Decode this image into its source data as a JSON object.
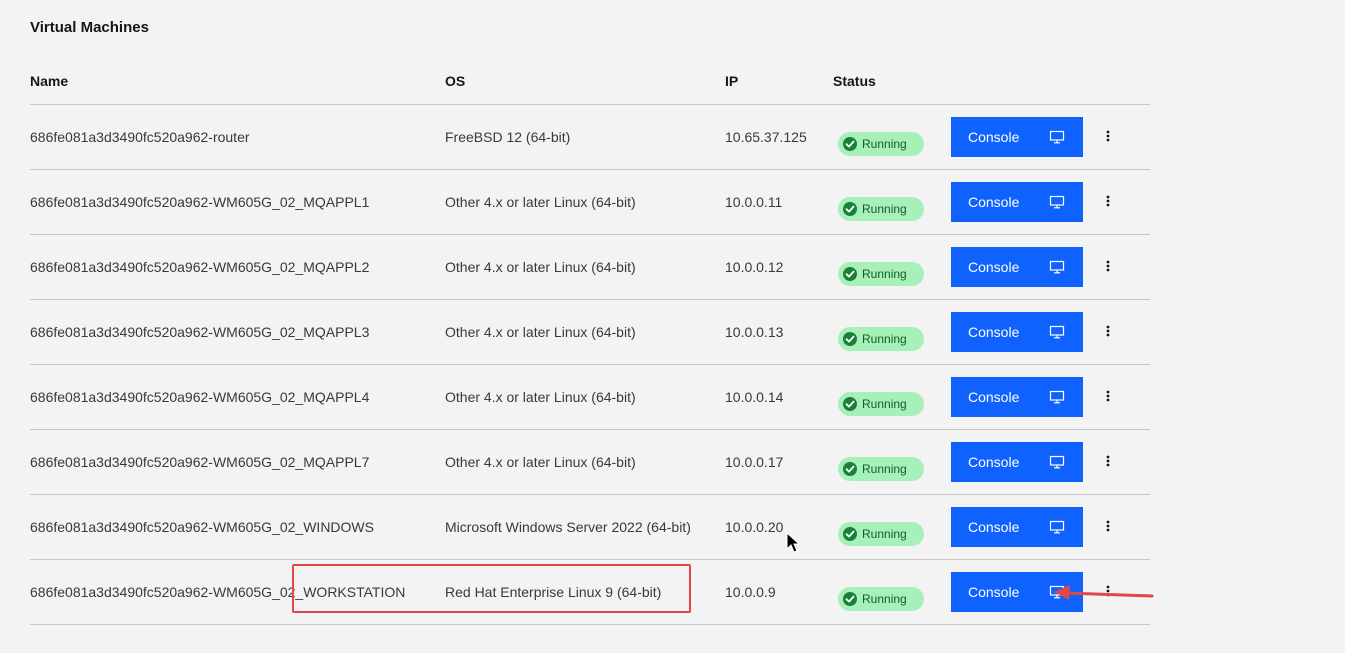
{
  "page": {
    "title": "Virtual Machines"
  },
  "table": {
    "headers": {
      "name": "Name",
      "os": "OS",
      "ip": "IP",
      "status": "Status"
    },
    "rows": [
      {
        "name": "686fe081a3d3490fc520a962-router",
        "os": "FreeBSD 12 (64-bit)",
        "ip": "10.65.37.125",
        "status": "Running"
      },
      {
        "name": "686fe081a3d3490fc520a962-WM605G_02_MQAPPL1",
        "os": "Other 4.x or later Linux (64-bit)",
        "ip": "10.0.0.11",
        "status": "Running"
      },
      {
        "name": "686fe081a3d3490fc520a962-WM605G_02_MQAPPL2",
        "os": "Other 4.x or later Linux (64-bit)",
        "ip": "10.0.0.12",
        "status": "Running"
      },
      {
        "name": "686fe081a3d3490fc520a962-WM605G_02_MQAPPL3",
        "os": "Other 4.x or later Linux (64-bit)",
        "ip": "10.0.0.13",
        "status": "Running"
      },
      {
        "name": "686fe081a3d3490fc520a962-WM605G_02_MQAPPL4",
        "os": "Other 4.x or later Linux (64-bit)",
        "ip": "10.0.0.14",
        "status": "Running"
      },
      {
        "name": "686fe081a3d3490fc520a962-WM605G_02_MQAPPL7",
        "os": "Other 4.x or later Linux (64-bit)",
        "ip": "10.0.0.17",
        "status": "Running"
      },
      {
        "name": "686fe081a3d3490fc520a962-WM605G_02_WINDOWS",
        "os": "Microsoft Windows Server 2022 (64-bit)",
        "ip": "10.0.0.20",
        "status": "Running"
      },
      {
        "name": "686fe081a3d3490fc520a962-WM605G_02_WORKSTATION",
        "os": "Red Hat Enterprise Linux 9 (64-bit)",
        "ip": "10.0.0.9",
        "status": "Running"
      }
    ],
    "console_label": "Console"
  },
  "icons": {
    "status": "checkmark-filled-icon",
    "console": "monitor-icon",
    "overflow": "overflow-menu-vertical-icon"
  },
  "colors": {
    "accent": "#0f62fe",
    "status_bg": "#a7f0ba",
    "status_icon": "#198038",
    "annotation": "#e04848"
  }
}
